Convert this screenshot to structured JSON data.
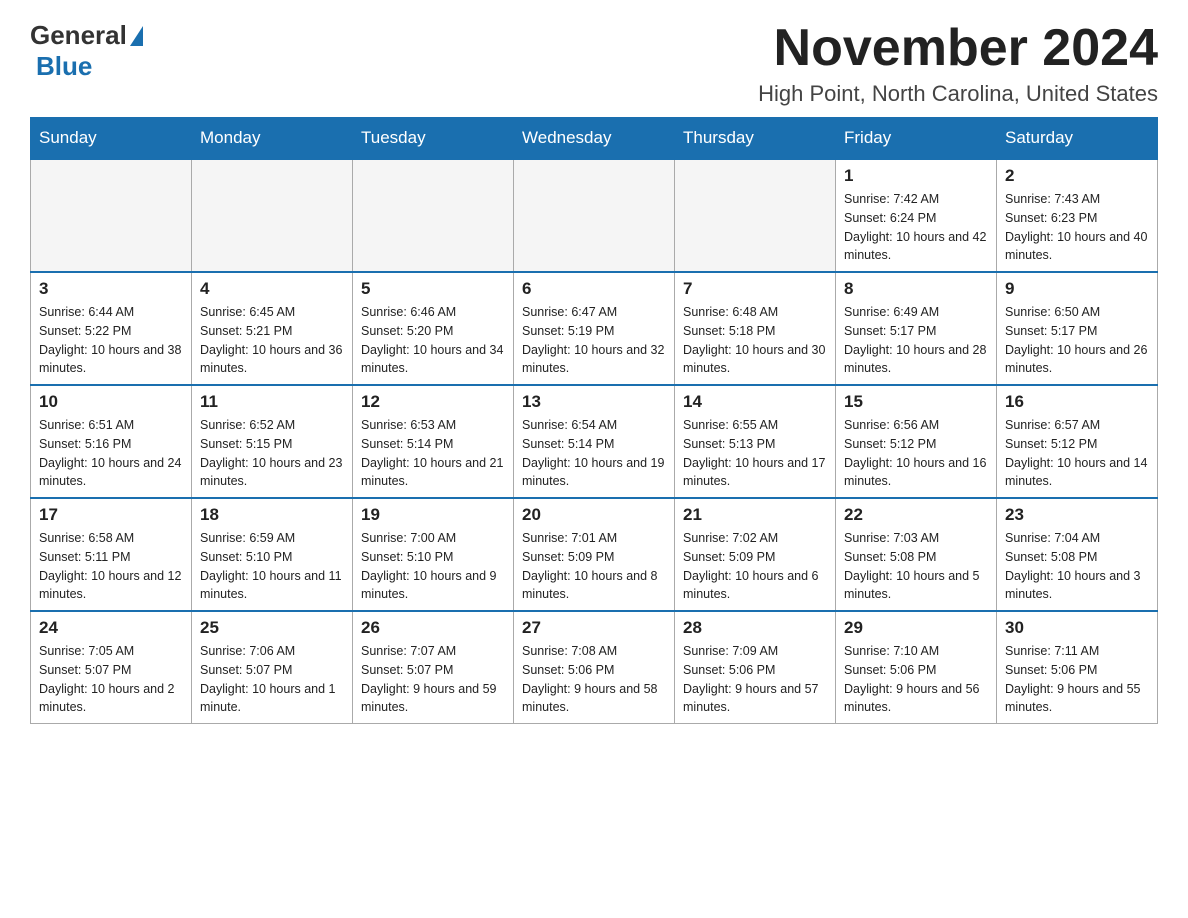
{
  "logo": {
    "text1": "General",
    "text2": "Blue"
  },
  "title": "November 2024",
  "location": "High Point, North Carolina, United States",
  "weekdays": [
    "Sunday",
    "Monday",
    "Tuesday",
    "Wednesday",
    "Thursday",
    "Friday",
    "Saturday"
  ],
  "weeks": [
    [
      {
        "day": "",
        "info": ""
      },
      {
        "day": "",
        "info": ""
      },
      {
        "day": "",
        "info": ""
      },
      {
        "day": "",
        "info": ""
      },
      {
        "day": "",
        "info": ""
      },
      {
        "day": "1",
        "info": "Sunrise: 7:42 AM\nSunset: 6:24 PM\nDaylight: 10 hours and 42 minutes."
      },
      {
        "day": "2",
        "info": "Sunrise: 7:43 AM\nSunset: 6:23 PM\nDaylight: 10 hours and 40 minutes."
      }
    ],
    [
      {
        "day": "3",
        "info": "Sunrise: 6:44 AM\nSunset: 5:22 PM\nDaylight: 10 hours and 38 minutes."
      },
      {
        "day": "4",
        "info": "Sunrise: 6:45 AM\nSunset: 5:21 PM\nDaylight: 10 hours and 36 minutes."
      },
      {
        "day": "5",
        "info": "Sunrise: 6:46 AM\nSunset: 5:20 PM\nDaylight: 10 hours and 34 minutes."
      },
      {
        "day": "6",
        "info": "Sunrise: 6:47 AM\nSunset: 5:19 PM\nDaylight: 10 hours and 32 minutes."
      },
      {
        "day": "7",
        "info": "Sunrise: 6:48 AM\nSunset: 5:18 PM\nDaylight: 10 hours and 30 minutes."
      },
      {
        "day": "8",
        "info": "Sunrise: 6:49 AM\nSunset: 5:17 PM\nDaylight: 10 hours and 28 minutes."
      },
      {
        "day": "9",
        "info": "Sunrise: 6:50 AM\nSunset: 5:17 PM\nDaylight: 10 hours and 26 minutes."
      }
    ],
    [
      {
        "day": "10",
        "info": "Sunrise: 6:51 AM\nSunset: 5:16 PM\nDaylight: 10 hours and 24 minutes."
      },
      {
        "day": "11",
        "info": "Sunrise: 6:52 AM\nSunset: 5:15 PM\nDaylight: 10 hours and 23 minutes."
      },
      {
        "day": "12",
        "info": "Sunrise: 6:53 AM\nSunset: 5:14 PM\nDaylight: 10 hours and 21 minutes."
      },
      {
        "day": "13",
        "info": "Sunrise: 6:54 AM\nSunset: 5:14 PM\nDaylight: 10 hours and 19 minutes."
      },
      {
        "day": "14",
        "info": "Sunrise: 6:55 AM\nSunset: 5:13 PM\nDaylight: 10 hours and 17 minutes."
      },
      {
        "day": "15",
        "info": "Sunrise: 6:56 AM\nSunset: 5:12 PM\nDaylight: 10 hours and 16 minutes."
      },
      {
        "day": "16",
        "info": "Sunrise: 6:57 AM\nSunset: 5:12 PM\nDaylight: 10 hours and 14 minutes."
      }
    ],
    [
      {
        "day": "17",
        "info": "Sunrise: 6:58 AM\nSunset: 5:11 PM\nDaylight: 10 hours and 12 minutes."
      },
      {
        "day": "18",
        "info": "Sunrise: 6:59 AM\nSunset: 5:10 PM\nDaylight: 10 hours and 11 minutes."
      },
      {
        "day": "19",
        "info": "Sunrise: 7:00 AM\nSunset: 5:10 PM\nDaylight: 10 hours and 9 minutes."
      },
      {
        "day": "20",
        "info": "Sunrise: 7:01 AM\nSunset: 5:09 PM\nDaylight: 10 hours and 8 minutes."
      },
      {
        "day": "21",
        "info": "Sunrise: 7:02 AM\nSunset: 5:09 PM\nDaylight: 10 hours and 6 minutes."
      },
      {
        "day": "22",
        "info": "Sunrise: 7:03 AM\nSunset: 5:08 PM\nDaylight: 10 hours and 5 minutes."
      },
      {
        "day": "23",
        "info": "Sunrise: 7:04 AM\nSunset: 5:08 PM\nDaylight: 10 hours and 3 minutes."
      }
    ],
    [
      {
        "day": "24",
        "info": "Sunrise: 7:05 AM\nSunset: 5:07 PM\nDaylight: 10 hours and 2 minutes."
      },
      {
        "day": "25",
        "info": "Sunrise: 7:06 AM\nSunset: 5:07 PM\nDaylight: 10 hours and 1 minute."
      },
      {
        "day": "26",
        "info": "Sunrise: 7:07 AM\nSunset: 5:07 PM\nDaylight: 9 hours and 59 minutes."
      },
      {
        "day": "27",
        "info": "Sunrise: 7:08 AM\nSunset: 5:06 PM\nDaylight: 9 hours and 58 minutes."
      },
      {
        "day": "28",
        "info": "Sunrise: 7:09 AM\nSunset: 5:06 PM\nDaylight: 9 hours and 57 minutes."
      },
      {
        "day": "29",
        "info": "Sunrise: 7:10 AM\nSunset: 5:06 PM\nDaylight: 9 hours and 56 minutes."
      },
      {
        "day": "30",
        "info": "Sunrise: 7:11 AM\nSunset: 5:06 PM\nDaylight: 9 hours and 55 minutes."
      }
    ]
  ]
}
